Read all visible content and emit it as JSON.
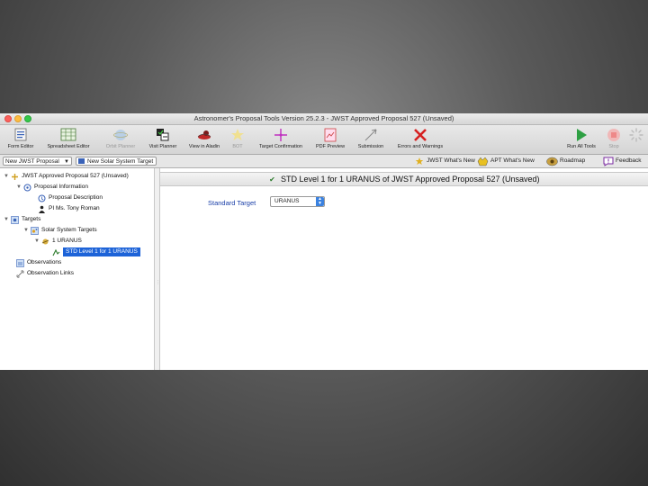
{
  "window": {
    "title": "Astronomer's Proposal Tools Version 25.2.3 - JWST Approved Proposal 527 (Unsaved)"
  },
  "toolbar": {
    "items": [
      {
        "label": "Form Editor",
        "icon": "form-editor-icon"
      },
      {
        "label": "Spreadsheet Editor",
        "icon": "spreadsheet-icon"
      },
      {
        "label": "Orbit Planner",
        "icon": "orbit-planner-icon"
      },
      {
        "label": "Visit Planner",
        "icon": "visit-planner-icon"
      },
      {
        "label": "View in Aladin",
        "icon": "aladin-icon"
      },
      {
        "label": "BOT",
        "icon": "star-icon"
      },
      {
        "label": "Target Confirmation",
        "icon": "crosshair-icon"
      },
      {
        "label": "PDF Preview",
        "icon": "pdf-icon"
      },
      {
        "label": "Submission",
        "icon": "submission-icon"
      },
      {
        "label": "Errors and Warnings",
        "icon": "error-x-icon"
      },
      {
        "label": "Run All Tools",
        "icon": "play-icon"
      },
      {
        "label": "Stop",
        "icon": "stop-icon"
      }
    ]
  },
  "subbar": {
    "selector_value": "New JWST Proposal",
    "new_target_label": "New Solar System Target",
    "links": [
      {
        "label": "JWST What's New",
        "icon": "news-icon"
      },
      {
        "label": "APT What's New",
        "icon": "apt-news-icon"
      },
      {
        "label": "Roadmap",
        "icon": "roadmap-icon"
      },
      {
        "label": "Feedback",
        "icon": "feedback-icon"
      }
    ]
  },
  "tree": {
    "root": "JWST Approved Proposal 527 (Unsaved)",
    "proposal_information": "Proposal Information",
    "proposal_description": "Proposal Description",
    "pi": "PI Ms. Tony Roman",
    "targets": "Targets",
    "solar_system_targets": "Solar System Targets",
    "uranus": "1 URANUS",
    "std_level": "STD Level 1 for 1 URANUS",
    "observations": "Observations",
    "observation_links": "Observation Links"
  },
  "content": {
    "header": "STD Level 1 for 1 URANUS of JWST Approved Proposal 527 (Unsaved)",
    "field_label": "Standard Target",
    "field_value": "URANUS"
  },
  "colors": {
    "selection": "#1d63d8",
    "field_label": "#1a3fa8",
    "run_green": "#2ea043",
    "error_red": "#d62020"
  }
}
